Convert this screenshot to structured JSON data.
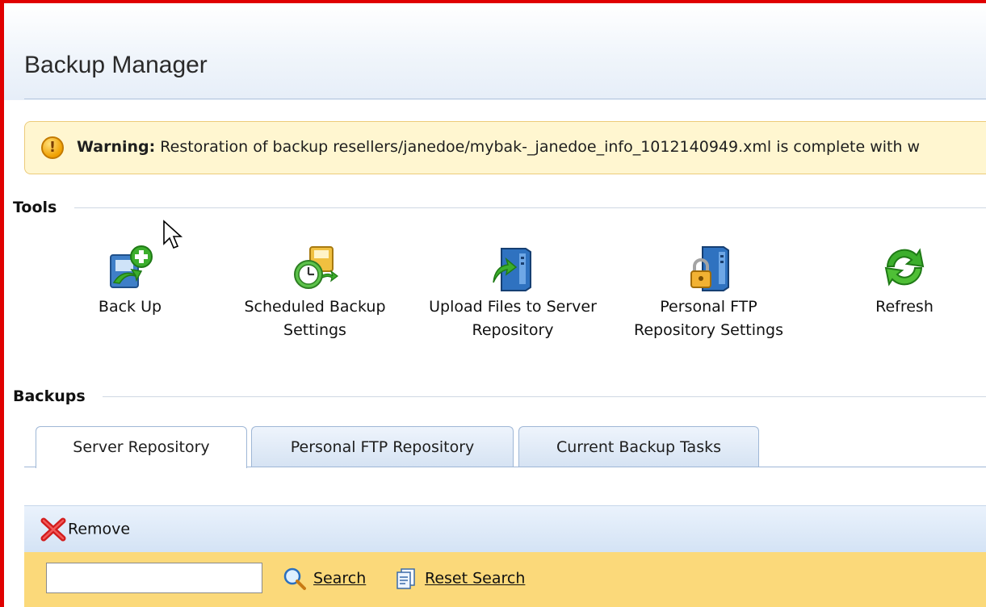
{
  "page": {
    "title": "Backup Manager"
  },
  "warning": {
    "label": "Warning:",
    "message": "Restoration of backup resellers/janedoe/mybak-_janedoe_info_1012140949.xml is complete with w"
  },
  "tools": {
    "section_title": "Tools",
    "back_up": {
      "label": "Back Up",
      "icon": "backup-add-icon"
    },
    "scheduled": {
      "line1": "Scheduled Backup",
      "line2": "Settings",
      "icon": "scheduled-backup-clock-icon"
    },
    "upload": {
      "line1": "Upload Files to Server",
      "line2": "Repository",
      "icon": "upload-server-icon"
    },
    "ftp": {
      "line1": "Personal FTP",
      "line2": "Repository Settings",
      "icon": "ftp-lock-icon"
    },
    "refresh": {
      "label": "Refresh",
      "icon": "refresh-icon"
    }
  },
  "backups": {
    "section_title": "Backups",
    "tabs": [
      {
        "label": "Server Repository",
        "active": true
      },
      {
        "label": "Personal FTP Repository",
        "active": false
      },
      {
        "label": "Current Backup Tasks",
        "active": false
      }
    ]
  },
  "toolbar": {
    "remove_label": "Remove"
  },
  "search": {
    "value": "",
    "search_label": "Search",
    "reset_label": "Reset Search"
  },
  "colors": {
    "frame": "#e00000",
    "warning_bg": "#fff6d0",
    "search_bar_bg": "#fbd97a",
    "toolbar_bg": "#dce8f6",
    "tab_border": "#9fb7d6"
  }
}
